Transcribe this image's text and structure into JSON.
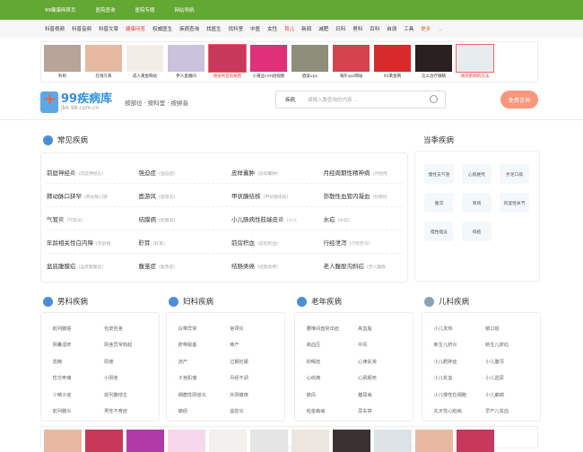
{
  "topbar": [
    "99健康网首页",
    "医院查询",
    "医院专题",
    "网站导航"
  ],
  "subnav": [
    {
      "t": "科普视频"
    },
    {
      "t": "科普音频"
    },
    {
      "t": "科普文章"
    },
    {
      "t": "健康问答",
      "c": "red"
    },
    {
      "t": "权威医生"
    },
    {
      "t": "疾病查询"
    },
    {
      "t": "找医生"
    },
    {
      "t": "找科室"
    },
    {
      "t": "中医"
    },
    {
      "t": "女性"
    },
    {
      "t": "育儿",
      "c": "red"
    },
    {
      "t": "新闻"
    },
    {
      "t": "减肥"
    },
    {
      "t": "妇科"
    },
    {
      "t": "男科"
    },
    {
      "t": "百科"
    },
    {
      "t": "自测"
    },
    {
      "t": "工具"
    },
    {
      "t": "更多",
      "c": "more"
    }
  ],
  "ads": [
    {
      "t": "秒射",
      "bg": "#b9a49a"
    },
    {
      "t": "在线写真",
      "bg": "#e6b9a0"
    },
    {
      "t": "成人黄金网站",
      "bg": "#f3ede8"
    },
    {
      "t": "伊人直播间",
      "bg": "#c9c3dd"
    },
    {
      "t": "德多利亚的秘密",
      "bg": "#c8385a",
      "red": true
    },
    {
      "t": "小黄豆crm短视频",
      "bg": "#e0307a"
    },
    {
      "t": "欧美vps",
      "bg": "#8e8f7a"
    },
    {
      "t": "海外vps网站",
      "bg": "#d4434e"
    },
    {
      "t": "91黄金网",
      "bg": "#d82a2a"
    },
    {
      "t": "怎么治疗眼睛",
      "bg": "#2a2020"
    },
    {
      "t": "填充脸颊的方法",
      "bg": "#e7ecef",
      "red": true
    }
  ],
  "logo": {
    "title": "99疾病库",
    "sub": "jbk.99.com.cn"
  },
  "bytype": "按部位 · 按科室 · 按拼音",
  "search": {
    "type": "疾病",
    "placeholder": "请输入要查询的内容 ..."
  },
  "consult": "免费咨询",
  "common": {
    "title": "常见疾病",
    "rows": [
      [
        [
          "前庭神经炎",
          "(前庭神经炎)"
        ],
        [
          "强迫症",
          "(强迫症)"
        ],
        [
          "皮样囊肿",
          "(皮样囊肿)"
        ],
        [
          "月经周期性精神病",
          "(月经周"
        ]
      ],
      [
        [
          "肺动脉口狭窄",
          "(肺动脉口狭"
        ],
        [
          "面游风",
          "(面游风)"
        ],
        [
          "甲状腺结核",
          "(甲状腺结核)"
        ],
        [
          "弥散性血管内凝血",
          "(弥散性"
        ]
      ],
      [
        [
          "气管炎",
          "(气管炎)"
        ],
        [
          "结膜病",
          "(结膜病)"
        ],
        [
          "小儿肠病性肢端皮炎",
          "(小儿"
        ],
        [
          "水疝",
          "(水疝)"
        ]
      ],
      [
        [
          "年龄相关性白内障",
          "(年龄相"
        ],
        [
          "聍耳",
          "(聍耳)"
        ],
        [
          "前房积血",
          "(前房积血)"
        ],
        [
          "行经泄泻",
          "(行经泄泻)"
        ]
      ],
      [
        [
          "盆底腹膜疝",
          "(盆底腹膜疝)"
        ],
        [
          "腹茧症",
          "(腹茧症)"
        ],
        [
          "结肠类癌",
          "(结肠类癌)"
        ],
        [
          "老人腹股沟斜疝",
          "(老人腹股"
        ]
      ]
    ]
  },
  "season": {
    "title": "当季疾病",
    "tags": [
      "慢性支气管",
      "心肌梗死",
      "手足口病",
      "腹泻",
      "胃病",
      "风湿性关节",
      "慢性咽炎",
      "痔疮"
    ]
  },
  "cats": [
    {
      "title": "男科疾病",
      "items": [
        "前列腺癌",
        "包皮包茎",
        "阴囊湿疹",
        "阴茎异常勃起",
        "遗精",
        "阳痿",
        "性交疼痛",
        "小阴茎",
        "少精子症",
        "前列腺增生",
        "前列腺炎",
        "男性不育症"
      ]
    },
    {
      "title": "妇科疾病",
      "items": [
        "白带异常",
        "宫颈炎",
        "脐带脱垂",
        "难产",
        "流产",
        "过期妊娠",
        "子宫肌瘤",
        "月经不调",
        "细菌性阴道炎",
        "外阴瘙痒",
        "痛经",
        "盆腔炎"
      ]
    },
    {
      "title": "老年疾病",
      "items": [
        "腰椎间盘突出症",
        "高血脂",
        "高血压",
        "中风",
        "抑郁症",
        "心律失常",
        "心绞痛",
        "心肌梗死",
        "痛风",
        "糖尿病",
        "帕金森病",
        "尿失禁"
      ]
    },
    {
      "title": "儿科疾病",
      "items": [
        "小儿发热",
        "鹅口疮",
        "新生儿脐炎",
        "新生儿脐疝",
        "小儿肥胖症",
        "小儿腹泻",
        "小儿贫血",
        "小儿遗尿",
        "小儿慢性粒细胞",
        "小儿癫痫",
        "先天性心脏病",
        "早产儿贫血"
      ]
    }
  ],
  "bottom_ads": [
    "#e6b9a0",
    "#c8385a",
    "#b13aa8",
    "#f7d7ec",
    "#f3f0ee",
    "#e5e5e5",
    "#ece6e1",
    "#3a3232",
    "#dde2e6",
    "#e6b9a0",
    "#c8385a"
  ]
}
